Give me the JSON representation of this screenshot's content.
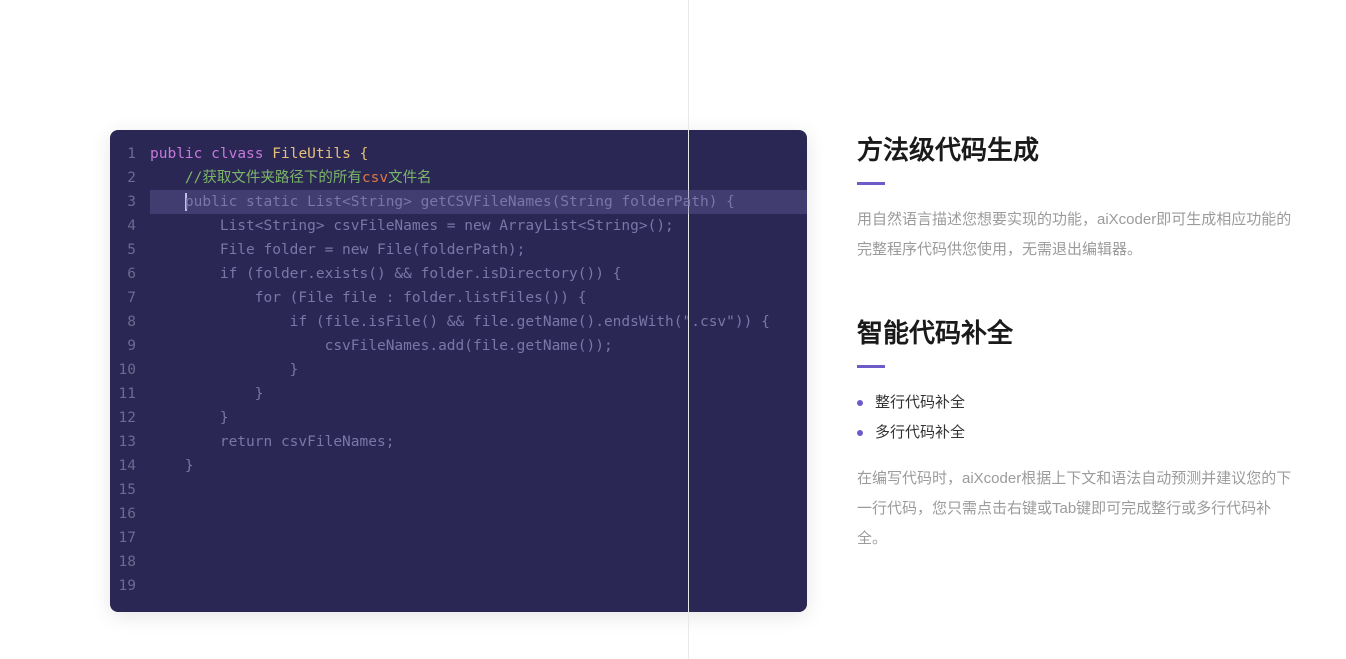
{
  "code": {
    "line1_kw1": "public",
    "line1_kw2": "clvass",
    "line1_type": "FileUtils",
    "line1_brace": "{",
    "line2_indent": "    ",
    "line2_comment_pre": "//获取文件夹路径下的所有",
    "line2_comment_hl": "csv",
    "line2_comment_post": "文件名",
    "line3_indent": "    ",
    "line3_text": "public static List<String> getCSVFileNames(String folderPath) {",
    "line4": "        List<String> csvFileNames = new ArrayList<String>();",
    "line5": "        File folder = new File(folderPath);",
    "line6": "        if (folder.exists() && folder.isDirectory()) {",
    "line7": "            for (File file : folder.listFiles()) {",
    "line8": "                if (file.isFile() && file.getName().endsWith(\".csv\")) {",
    "line9": "                    csvFileNames.add(file.getName());",
    "line10": "                }",
    "line11": "            }",
    "line12": "        }",
    "line13": "        return csvFileNames;",
    "line14": "    }",
    "line15": "",
    "line16": "",
    "line17": "",
    "line18": "",
    "line19": ""
  },
  "ln": {
    "1": "1",
    "2": "2",
    "3": "3",
    "4": "4",
    "5": "5",
    "6": "6",
    "7": "7",
    "8": "8",
    "9": "9",
    "10": "10",
    "11": "11",
    "12": "12",
    "13": "13",
    "14": "14",
    "15": "15",
    "16": "16",
    "17": "17",
    "18": "18",
    "19": "19"
  },
  "section1": {
    "title": "方法级代码生成",
    "desc": "用自然语言描述您想要实现的功能，aiXcoder即可生成相应功能的完整程序代码供您使用，无需退出编辑器。"
  },
  "section2": {
    "title": "智能代码补全",
    "bullet1": "整行代码补全",
    "bullet2": "多行代码补全",
    "desc": "在编写代码时，aiXcoder根据上下文和语法自动预测并建议您的下一行代码，您只需点击右键或Tab键即可完成整行或多行代码补全。"
  }
}
